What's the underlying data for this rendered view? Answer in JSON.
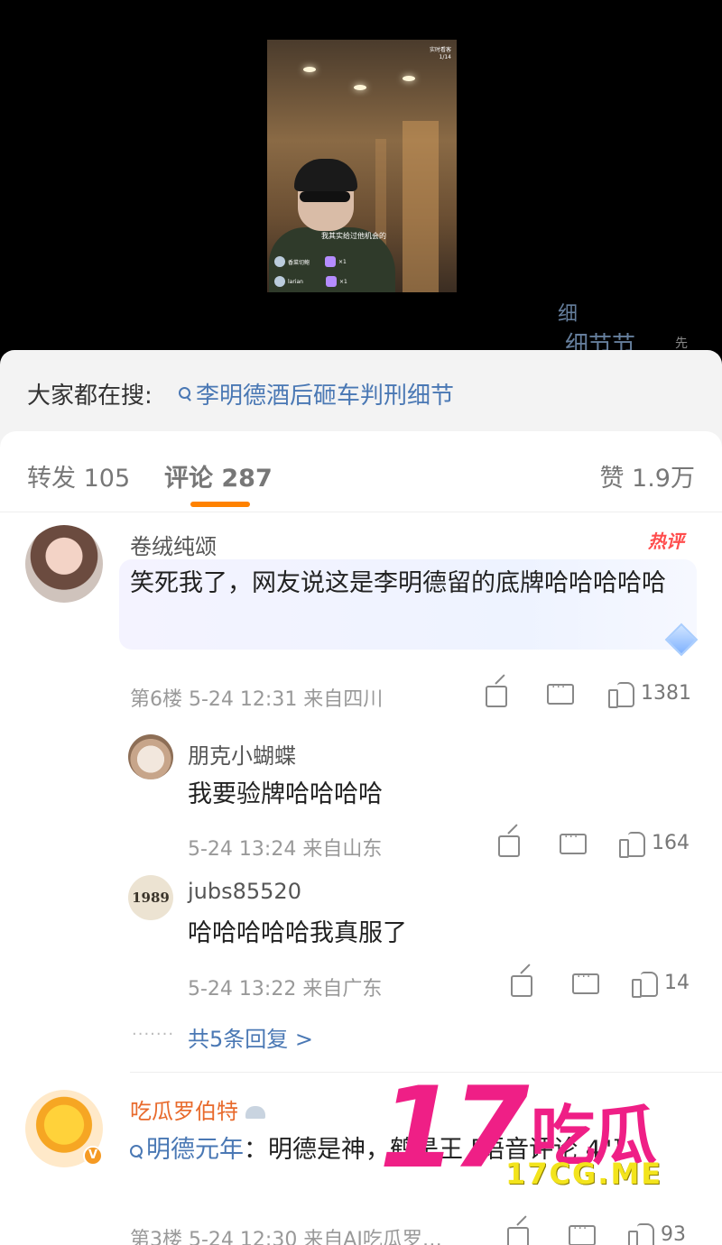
{
  "video": {
    "caption": "我其实给过他机会的",
    "counter_top": "实时看客",
    "counter_page": "1/14",
    "viewers": [
      {
        "name": "香菜切鲍",
        "count": "×1"
      },
      {
        "name": "larian",
        "count": "×1"
      }
    ]
  },
  "peek": {
    "line1": "细",
    "line2": "细节节",
    "gray": "先"
  },
  "search": {
    "label": "大家都在搜:",
    "term": "李明德酒后砸车判刑细节"
  },
  "tabs": {
    "repost": "转发 105",
    "comments": "评论 287",
    "likes": "赞 1.9万"
  },
  "comments": [
    {
      "author": "卷绒纯颂",
      "badge": "热评",
      "text": "笑死我了，网友说这是李明德留的底牌哈哈哈哈哈",
      "meta": "第6楼 5-24 12:31 来自四川",
      "likes": "1381",
      "replies": [
        {
          "author": "朋克小蝴蝶",
          "text": "我要验牌哈哈哈哈",
          "meta": "5-24 13:24 来自山东",
          "likes": "164"
        },
        {
          "author": "jubs85520",
          "avatar_text": "1989",
          "text": "哈哈哈哈哈我真服了",
          "meta": "5-24 13:22 来自广东",
          "likes": "14"
        }
      ],
      "more_replies": "共5条回复 >"
    },
    {
      "author": "吃瓜罗伯特",
      "verified": "V",
      "link": "明德元年",
      "text": "：明德是神，鹤是王 [语音评论 4\"]",
      "meta": "第3楼 5-24 12:30 来自AI吃瓜罗…",
      "likes": "93"
    }
  ],
  "watermark": {
    "logo_digits": "17",
    "logo_hanzi": "吃瓜",
    "site": "17CG.ME"
  },
  "colors": {
    "accent": "#ff8200",
    "link": "#4a78b4",
    "hot": "#ff4d4d",
    "watermark_pink": "#ef1f86",
    "watermark_yellow": "#f3e41c"
  }
}
